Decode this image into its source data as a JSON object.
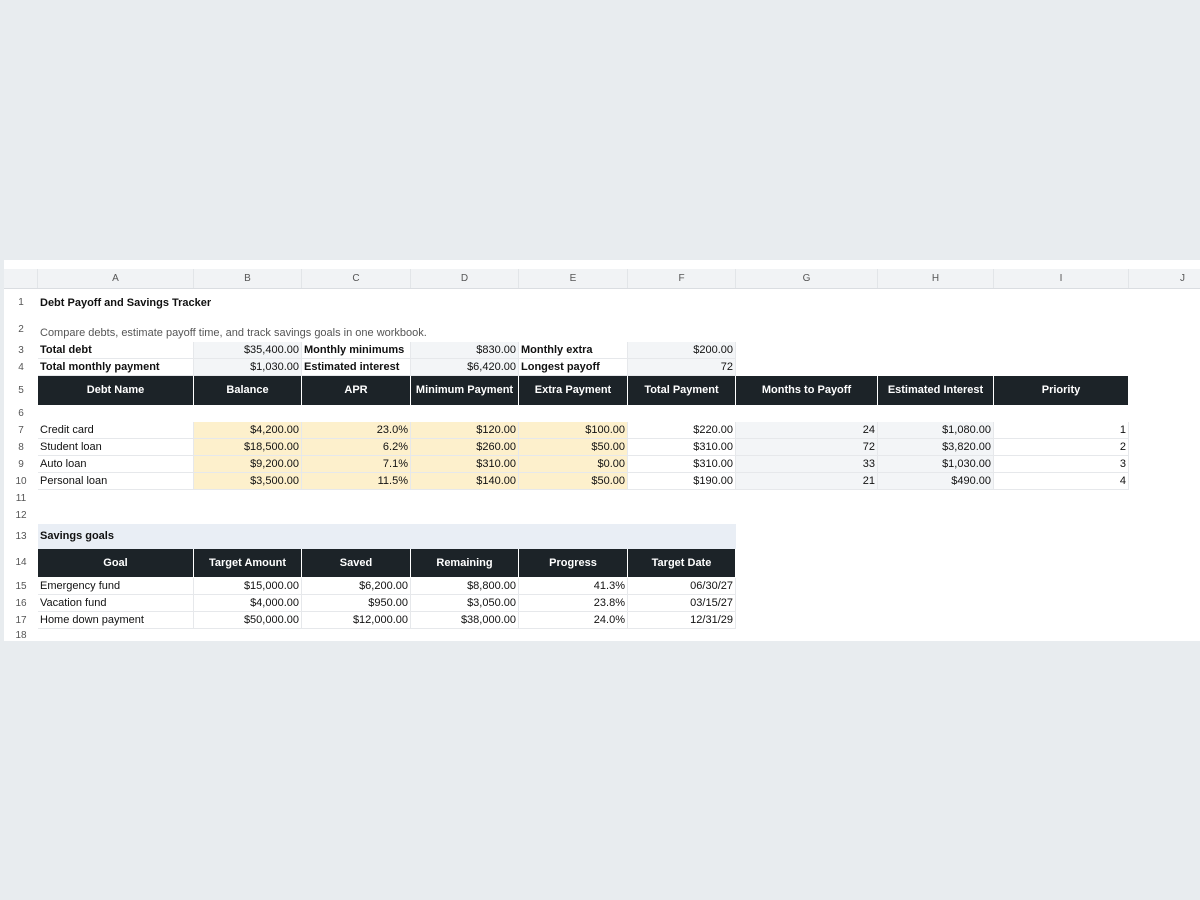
{
  "columns": [
    "A",
    "B",
    "C",
    "D",
    "E",
    "F",
    "G",
    "H",
    "I",
    "J"
  ],
  "row_numbers": [
    "1",
    "2",
    "3",
    "4",
    "5",
    "6",
    "7",
    "8",
    "9",
    "10",
    "11",
    "12",
    "13",
    "14",
    "15",
    "16",
    "17",
    "18"
  ],
  "title": "Debt Payoff and Savings Tracker",
  "subtitle": "Compare debts, estimate payoff time, and track savings goals in one workbook.",
  "summary": {
    "total_debt_label": "Total debt",
    "total_debt_value": "$35,400.00",
    "monthly_minimums_label": "Monthly minimums",
    "monthly_minimums_value": "$830.00",
    "monthly_extra_label": "Monthly extra",
    "monthly_extra_value": "$200.00",
    "total_monthly_payment_label": "Total monthly payment",
    "total_monthly_payment_value": "$1,030.00",
    "estimated_interest_label": "Estimated interest",
    "estimated_interest_value": "$6,420.00",
    "longest_payoff_label": "Longest payoff",
    "longest_payoff_value": "72"
  },
  "debt_headers": [
    "Debt Name",
    "Balance",
    "APR",
    "Minimum Payment",
    "Extra Payment",
    "Total Payment",
    "Months to Payoff",
    "Estimated Interest",
    "Priority"
  ],
  "debts": [
    [
      "Credit card",
      "$4,200.00",
      "23.0%",
      "$120.00",
      "$100.00",
      "$220.00",
      "24",
      "$1,080.00",
      "1"
    ],
    [
      "Student loan",
      "$18,500.00",
      "6.2%",
      "$260.00",
      "$50.00",
      "$310.00",
      "72",
      "$3,820.00",
      "2"
    ],
    [
      "Auto loan",
      "$9,200.00",
      "7.1%",
      "$310.00",
      "$0.00",
      "$310.00",
      "33",
      "$1,030.00",
      "3"
    ],
    [
      "Personal loan",
      "$3,500.00",
      "11.5%",
      "$140.00",
      "$50.00",
      "$190.00",
      "21",
      "$490.00",
      "4"
    ]
  ],
  "savings_section_label": "Savings goals",
  "savings_headers": [
    "Goal",
    "Target Amount",
    "Saved",
    "Remaining",
    "Progress",
    "Target Date"
  ],
  "savings": [
    [
      "Emergency fund",
      "$15,000.00",
      "$6,200.00",
      "$8,800.00",
      "41.3%",
      "06/30/27"
    ],
    [
      "Vacation fund",
      "$4,000.00",
      "$950.00",
      "$3,050.00",
      "23.8%",
      "03/15/27"
    ],
    [
      "Home down payment",
      "$50,000.00",
      "$12,000.00",
      "$38,000.00",
      "24.0%",
      "12/31/29"
    ]
  ]
}
